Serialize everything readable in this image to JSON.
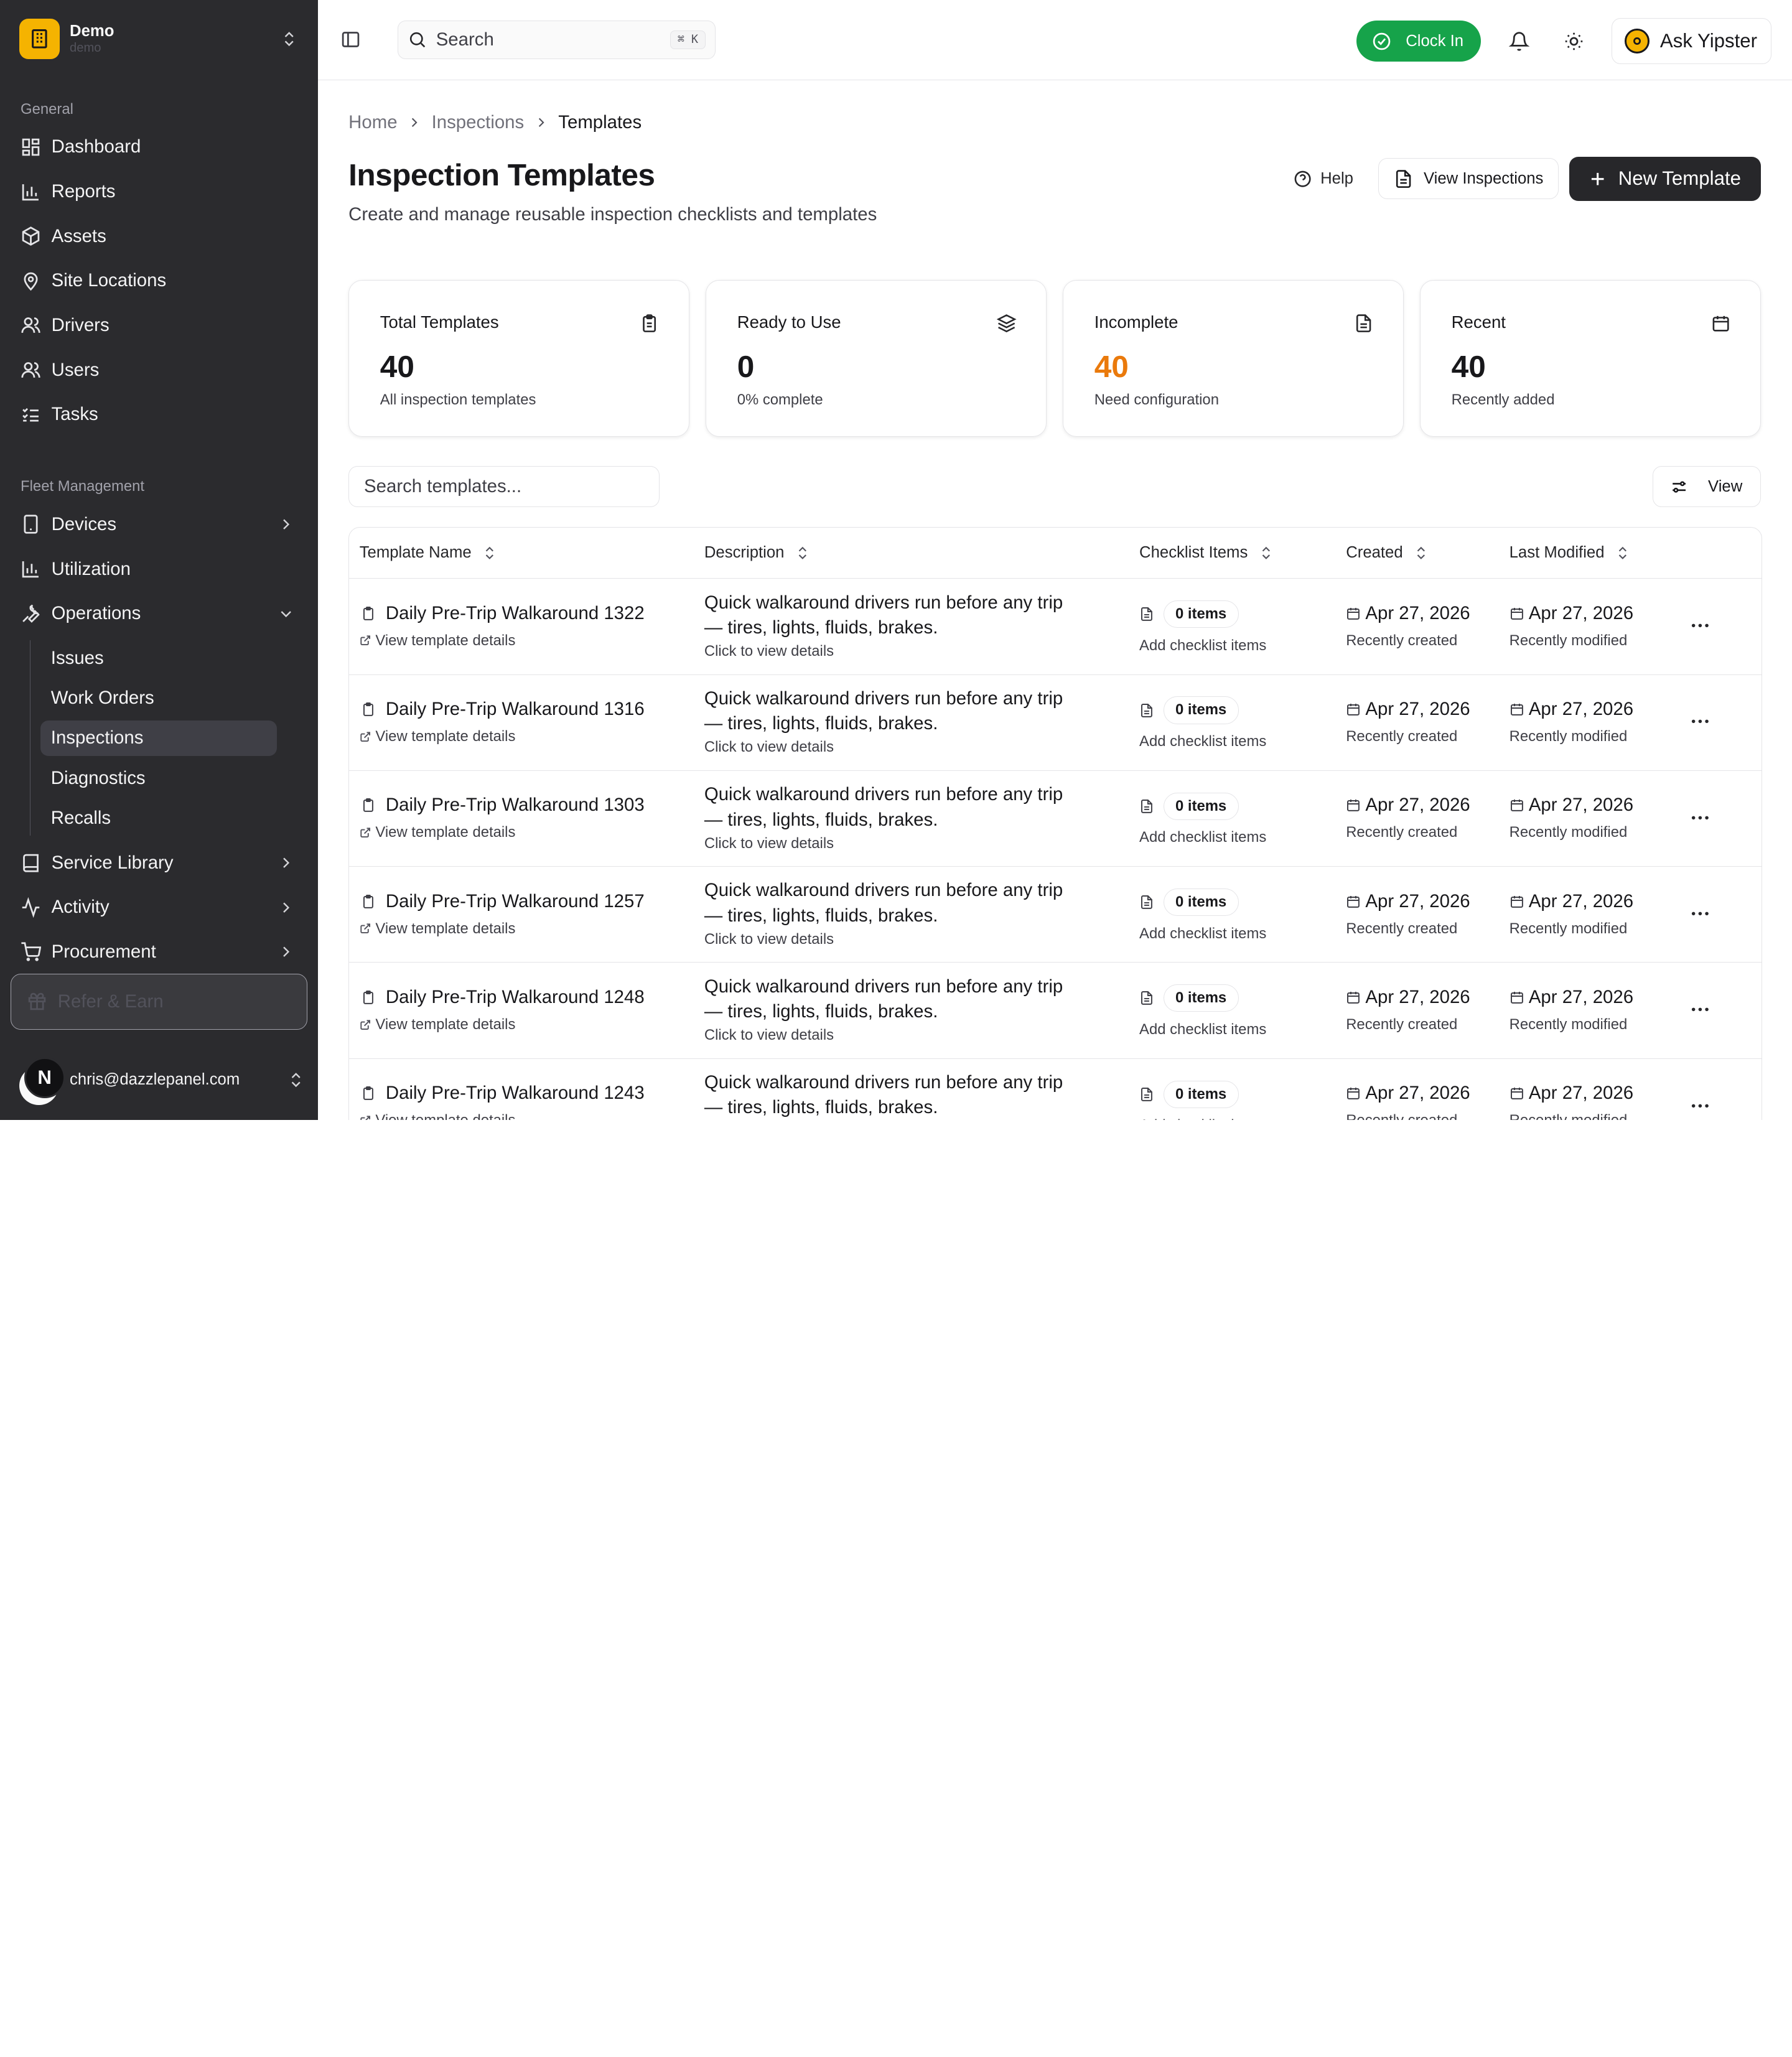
{
  "workspace": {
    "name": "Demo",
    "slug": "demo"
  },
  "sidebar": {
    "general_label": "General",
    "general_items": [
      {
        "label": "Dashboard",
        "icon": "dashboard-icon"
      },
      {
        "label": "Reports",
        "icon": "bar-chart-icon"
      },
      {
        "label": "Assets",
        "icon": "package-icon"
      },
      {
        "label": "Site Locations",
        "icon": "map-pin-icon"
      },
      {
        "label": "Drivers",
        "icon": "users-icon"
      },
      {
        "label": "Users",
        "icon": "users-icon"
      },
      {
        "label": "Tasks",
        "icon": "list-checks-icon"
      }
    ],
    "fleet_label": "Fleet Management",
    "fleet_items": {
      "devices": "Devices",
      "utilization": "Utilization",
      "operations": "Operations",
      "operations_sub": [
        "Issues",
        "Work Orders",
        "Inspections",
        "Diagnostics",
        "Recalls"
      ],
      "active_sub": "Inspections",
      "service_library": "Service Library",
      "activity": "Activity",
      "procurement": "Procurement"
    },
    "refer_label": "Refer & Earn",
    "user": {
      "initial": "N",
      "email": "chris@dazzlepanel.com"
    }
  },
  "topbar": {
    "search_placeholder": "Search",
    "shortcut": "⌘ K",
    "clock_in_label": "Clock In",
    "ask_label": "Ask Yipster"
  },
  "breadcrumb": [
    "Home",
    "Inspections",
    "Templates"
  ],
  "page": {
    "title": "Inspection Templates",
    "subtitle": "Create and manage reusable inspection checklists and templates",
    "help_label": "Help",
    "view_inspections_label": "View Inspections",
    "new_template_label": "New Template"
  },
  "stats": [
    {
      "label": "Total Templates",
      "value": "40",
      "note": "All inspection templates",
      "icon": "clipboard-icon"
    },
    {
      "label": "Ready to Use",
      "value": "0",
      "note": "0% complete",
      "icon": "layers-icon"
    },
    {
      "label": "Incomplete",
      "value": "40",
      "note": "Need configuration",
      "icon": "file-text-icon",
      "color": "#ea7a0c"
    },
    {
      "label": "Recent",
      "value": "40",
      "note": "Recently added",
      "icon": "calendar-icon"
    }
  ],
  "filter": {
    "placeholder": "Search templates...",
    "view_label": "View"
  },
  "table": {
    "columns": [
      "Template Name",
      "Description",
      "Checklist Items",
      "Created",
      "Last Modified"
    ],
    "row_link_label": "View template details",
    "desc_link_label": "Click to view details",
    "items_note": "Add checklist items",
    "created_note": "Recently created",
    "modified_note": "Recently modified",
    "rows": [
      {
        "name": "Daily Pre-Trip Walkaround 1322",
        "description": "Quick walkaround drivers run before any trip — tires, lights, fluids, brakes.",
        "items": "0 items",
        "created": "Apr 27, 2026",
        "modified": "Apr 27, 2026"
      },
      {
        "name": "Daily Pre-Trip Walkaround 1316",
        "description": "Quick walkaround drivers run before any trip — tires, lights, fluids, brakes.",
        "items": "0 items",
        "created": "Apr 27, 2026",
        "modified": "Apr 27, 2026"
      },
      {
        "name": "Daily Pre-Trip Walkaround 1303",
        "description": "Quick walkaround drivers run before any trip — tires, lights, fluids, brakes.",
        "items": "0 items",
        "created": "Apr 27, 2026",
        "modified": "Apr 27, 2026"
      },
      {
        "name": "Daily Pre-Trip Walkaround 1257",
        "description": "Quick walkaround drivers run before any trip — tires, lights, fluids, brakes.",
        "items": "0 items",
        "created": "Apr 27, 2026",
        "modified": "Apr 27, 2026"
      },
      {
        "name": "Daily Pre-Trip Walkaround 1248",
        "description": "Quick walkaround drivers run before any trip — tires, lights, fluids, brakes.",
        "items": "0 items",
        "created": "Apr 27, 2026",
        "modified": "Apr 27, 2026"
      },
      {
        "name": "Daily Pre-Trip Walkaround 1243",
        "description": "Quick walkaround drivers run before any trip — tires, lights, fluids, brakes.",
        "items": "0 items",
        "created": "Apr 27, 2026",
        "modified": "Apr 27, 2026"
      }
    ]
  },
  "colors": {
    "sidebar_bg": "#2b2b2e",
    "brand": "#f5b301",
    "clock_in": "#16a34a",
    "incomplete": "#ea7a0c",
    "primary": "#27272a"
  }
}
